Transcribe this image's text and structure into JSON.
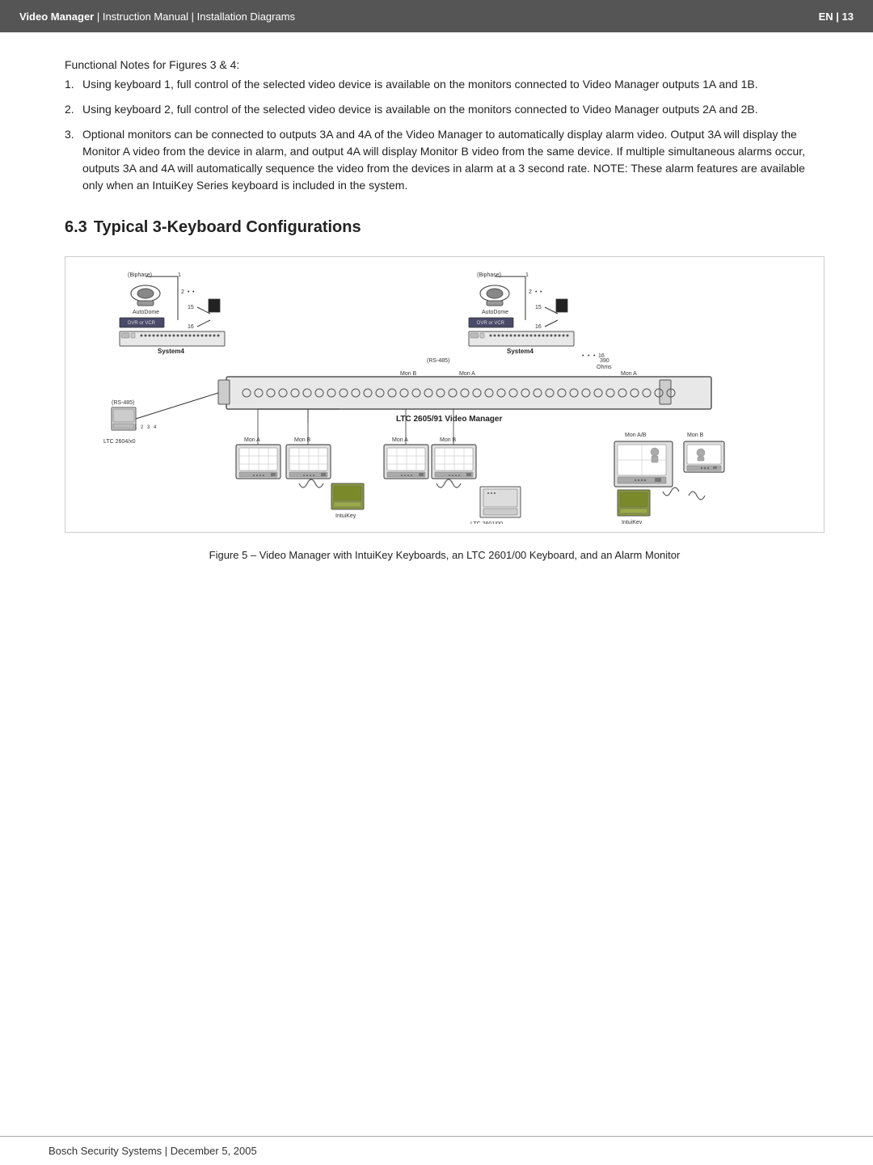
{
  "header": {
    "left_bold": "Video Manager",
    "left_text": " | Instruction Manual | Installation Diagrams",
    "right_text": "EN | 13"
  },
  "functional_notes": {
    "intro": "Functional Notes for Figures 3 & 4:",
    "items": [
      {
        "num": "1.",
        "text": "Using keyboard 1, full control of the selected video device is available on the monitors connected to Video Manager outputs 1A and 1B."
      },
      {
        "num": "2.",
        "text": "Using keyboard 2, full control of the selected video device is available on the monitors connected to Video Manager outputs 2A and 2B."
      },
      {
        "num": "3.",
        "text": "Optional monitors can be connected to outputs 3A and 4A of the Video Manager to automatically display alarm video. Output 3A will display the Monitor A video from the device in alarm, and output 4A will display Monitor B video from the same device. If multiple simultaneous alarms occur, outputs 3A and 4A will automatically sequence the video from the devices in alarm at a 3 second rate. NOTE: These alarm features are available only when an IntuiKey Series keyboard is included in the system."
      }
    ]
  },
  "section": {
    "num": "6.3",
    "title": "Typical 3‑Keyboard Configurations"
  },
  "figure_caption": "Figure 5 – Video Manager with IntuiKey Keyboards, an LTC 2601/00 Keyboard, and an Alarm Monitor",
  "footer": {
    "text": "Bosch Security Systems | December 5, 2005"
  }
}
